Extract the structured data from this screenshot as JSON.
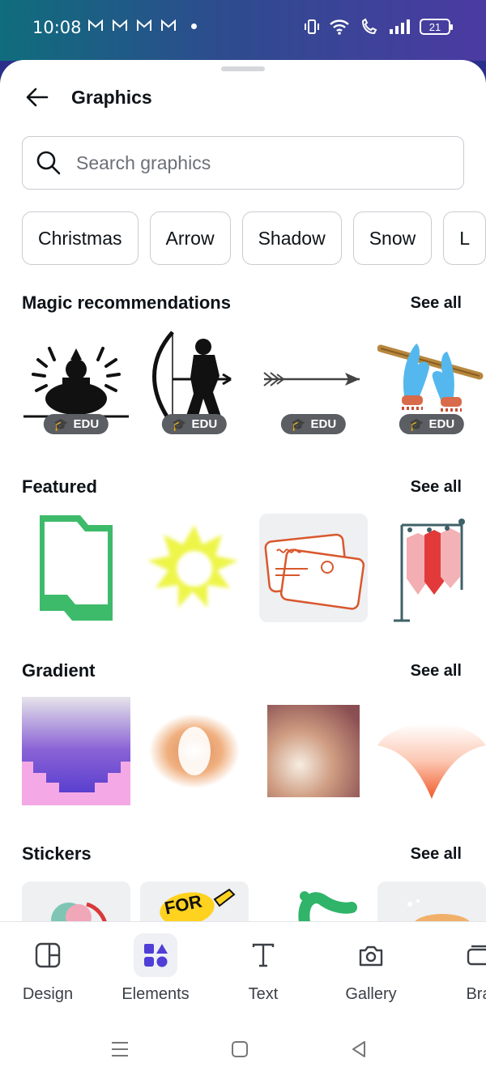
{
  "status_bar": {
    "time": "10:08",
    "battery": "21"
  },
  "header": {
    "title": "Graphics"
  },
  "search": {
    "placeholder": "Search graphics"
  },
  "chips": [
    "Christmas",
    "Arrow",
    "Shadow",
    "Snow",
    "L"
  ],
  "sections": {
    "magic": {
      "title": "Magic recommendations",
      "see_all": "See all",
      "badge": "EDU"
    },
    "featured": {
      "title": "Featured",
      "see_all": "See all"
    },
    "gradient": {
      "title": "Gradient",
      "see_all": "See all"
    },
    "stickers": {
      "title": "Stickers",
      "see_all": "See all",
      "sticker_text": "FOR"
    }
  },
  "bottom_nav": {
    "design": "Design",
    "elements": "Elements",
    "text": "Text",
    "gallery": "Gallery",
    "brand": "Bra"
  },
  "colors": {
    "accent": "#4f3fd6",
    "green": "#3dbb6a",
    "yellow": "#eef54a"
  }
}
